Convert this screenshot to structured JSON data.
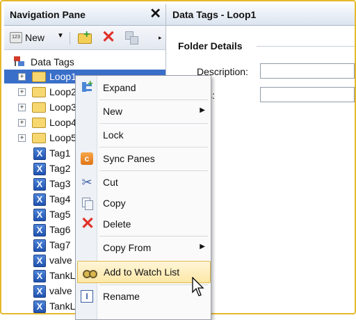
{
  "nav_pane": {
    "title": "Navigation Pane",
    "close_glyph": "✕",
    "toolbar": {
      "new_label": "New",
      "new_icon_text": "123",
      "more_glyph": "▸"
    },
    "tree": {
      "root_label": "Data Tags",
      "folders": [
        "Loop1",
        "Loop2",
        "Loop3",
        "Loop4",
        "Loop5"
      ],
      "selected_folder": "Loop1",
      "tags": [
        "Tag1",
        "Tag2",
        "Tag3",
        "Tag4",
        "Tag5",
        "Tag6",
        "Tag7",
        "valve",
        "TankL",
        "valve",
        "TankL"
      ]
    }
  },
  "detail_pane": {
    "title": "Data Tags - Loop1",
    "section_title": "Folder Details",
    "description_label": "Description:",
    "description_value": "",
    "address_label": "ss:",
    "address_value": ""
  },
  "context_menu": {
    "items": [
      {
        "label": "Expand",
        "icon": "expand-icon"
      },
      {
        "label": "New",
        "icon": "",
        "submenu": true
      },
      {
        "label": "Lock",
        "icon": ""
      },
      {
        "label": "Sync Panes",
        "icon": "sync-panes-icon"
      },
      {
        "label": "Cut",
        "icon": "scissors-icon"
      },
      {
        "label": "Copy",
        "icon": "copy-icon"
      },
      {
        "label": "Delete",
        "icon": "delete-icon"
      },
      {
        "label": "Copy From",
        "icon": "",
        "submenu": true
      },
      {
        "label": "Add to Watch List",
        "icon": "glasses-icon",
        "highlighted": true
      },
      {
        "label": "Rename",
        "icon": "rename-icon"
      }
    ],
    "submenu_glyph": "▶"
  },
  "colors": {
    "frame_border": "#e6b92c",
    "selection": "#3a6fc9",
    "highlight": "#fde7a6"
  }
}
